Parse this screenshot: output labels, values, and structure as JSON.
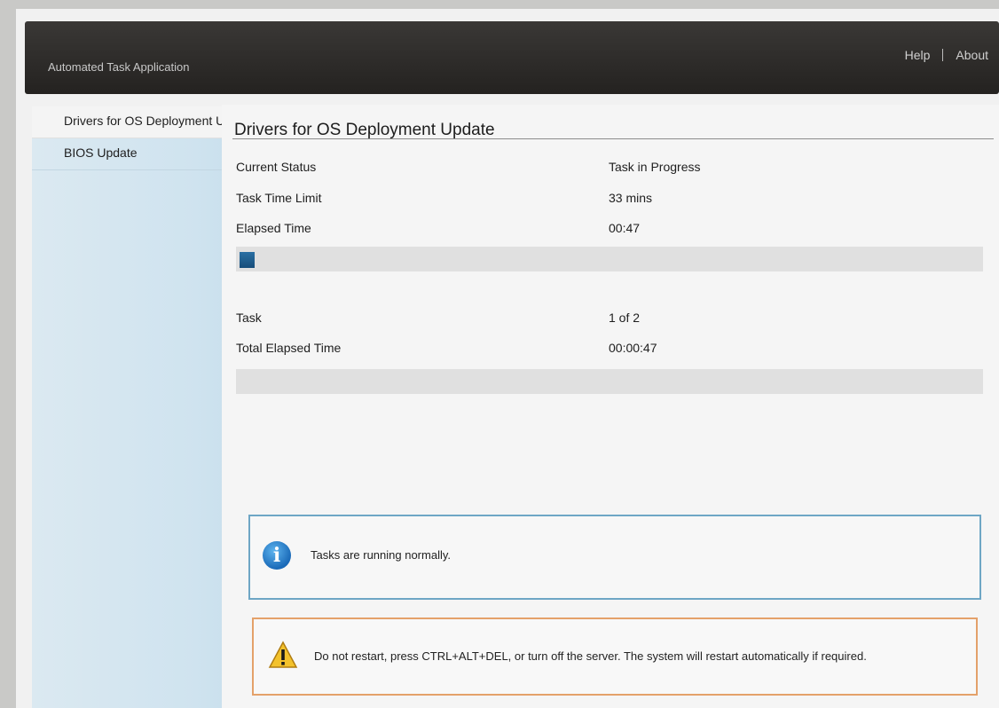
{
  "header": {
    "app_title": "Automated Task Application",
    "help_label": "Help",
    "about_label": "About"
  },
  "sidebar": {
    "items": [
      {
        "label": "Drivers for OS Deployment U..",
        "active": true
      },
      {
        "label": "BIOS Update",
        "active": false
      }
    ]
  },
  "main": {
    "title": "Drivers for OS Deployment Update",
    "status": {
      "current_status_label": "Current Status",
      "current_status_value": "Task in Progress",
      "time_limit_label": "Task Time Limit",
      "time_limit_value": "33 mins",
      "elapsed_label": "Elapsed Time",
      "elapsed_value": "00:47"
    },
    "task_progress_fraction": 0.02,
    "summary": {
      "task_label": "Task",
      "task_value": "1 of 2",
      "total_elapsed_label": "Total Elapsed Time",
      "total_elapsed_value": "00:00:47"
    },
    "overall_progress_fraction": 0.0
  },
  "messages": {
    "info": {
      "icon": "info-icon",
      "text": "Tasks are running normally."
    },
    "warning": {
      "icon": "warning-icon",
      "text": "Do not restart, press CTRL+ALT+DEL, or turn off the server.  The system will restart automatically if required."
    }
  }
}
